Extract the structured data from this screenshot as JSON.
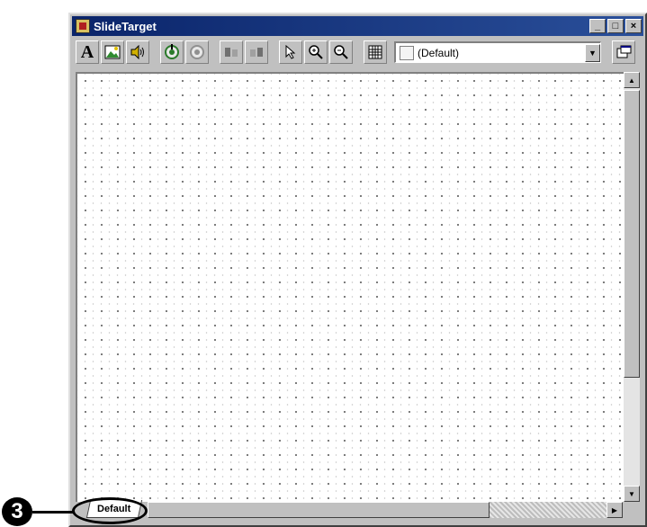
{
  "window": {
    "title": "SlideTarget"
  },
  "toolbar": {
    "buttons": [
      {
        "name": "text-tool",
        "icon": "A"
      },
      {
        "name": "image-tool",
        "icon": "image-icon"
      },
      {
        "name": "sound-tool",
        "icon": "speaker-icon"
      },
      {
        "name": "add-target",
        "icon": "target-plus-icon"
      },
      {
        "name": "remove-target",
        "icon": "target-minus-icon"
      },
      {
        "name": "align-left",
        "icon": "align-icon"
      },
      {
        "name": "align-right",
        "icon": "align-icon"
      },
      {
        "name": "pointer-tool",
        "icon": "arrow-icon"
      },
      {
        "name": "zoom-in",
        "icon": "magnifier-plus-icon"
      },
      {
        "name": "zoom-out",
        "icon": "magnifier-minus-icon"
      },
      {
        "name": "grid-toggle",
        "icon": "grid-icon"
      }
    ],
    "layer_combo": {
      "value": "(Default)"
    }
  },
  "tabs": [
    {
      "label": "Default",
      "selected": true
    }
  ],
  "callout": {
    "number": "3"
  }
}
